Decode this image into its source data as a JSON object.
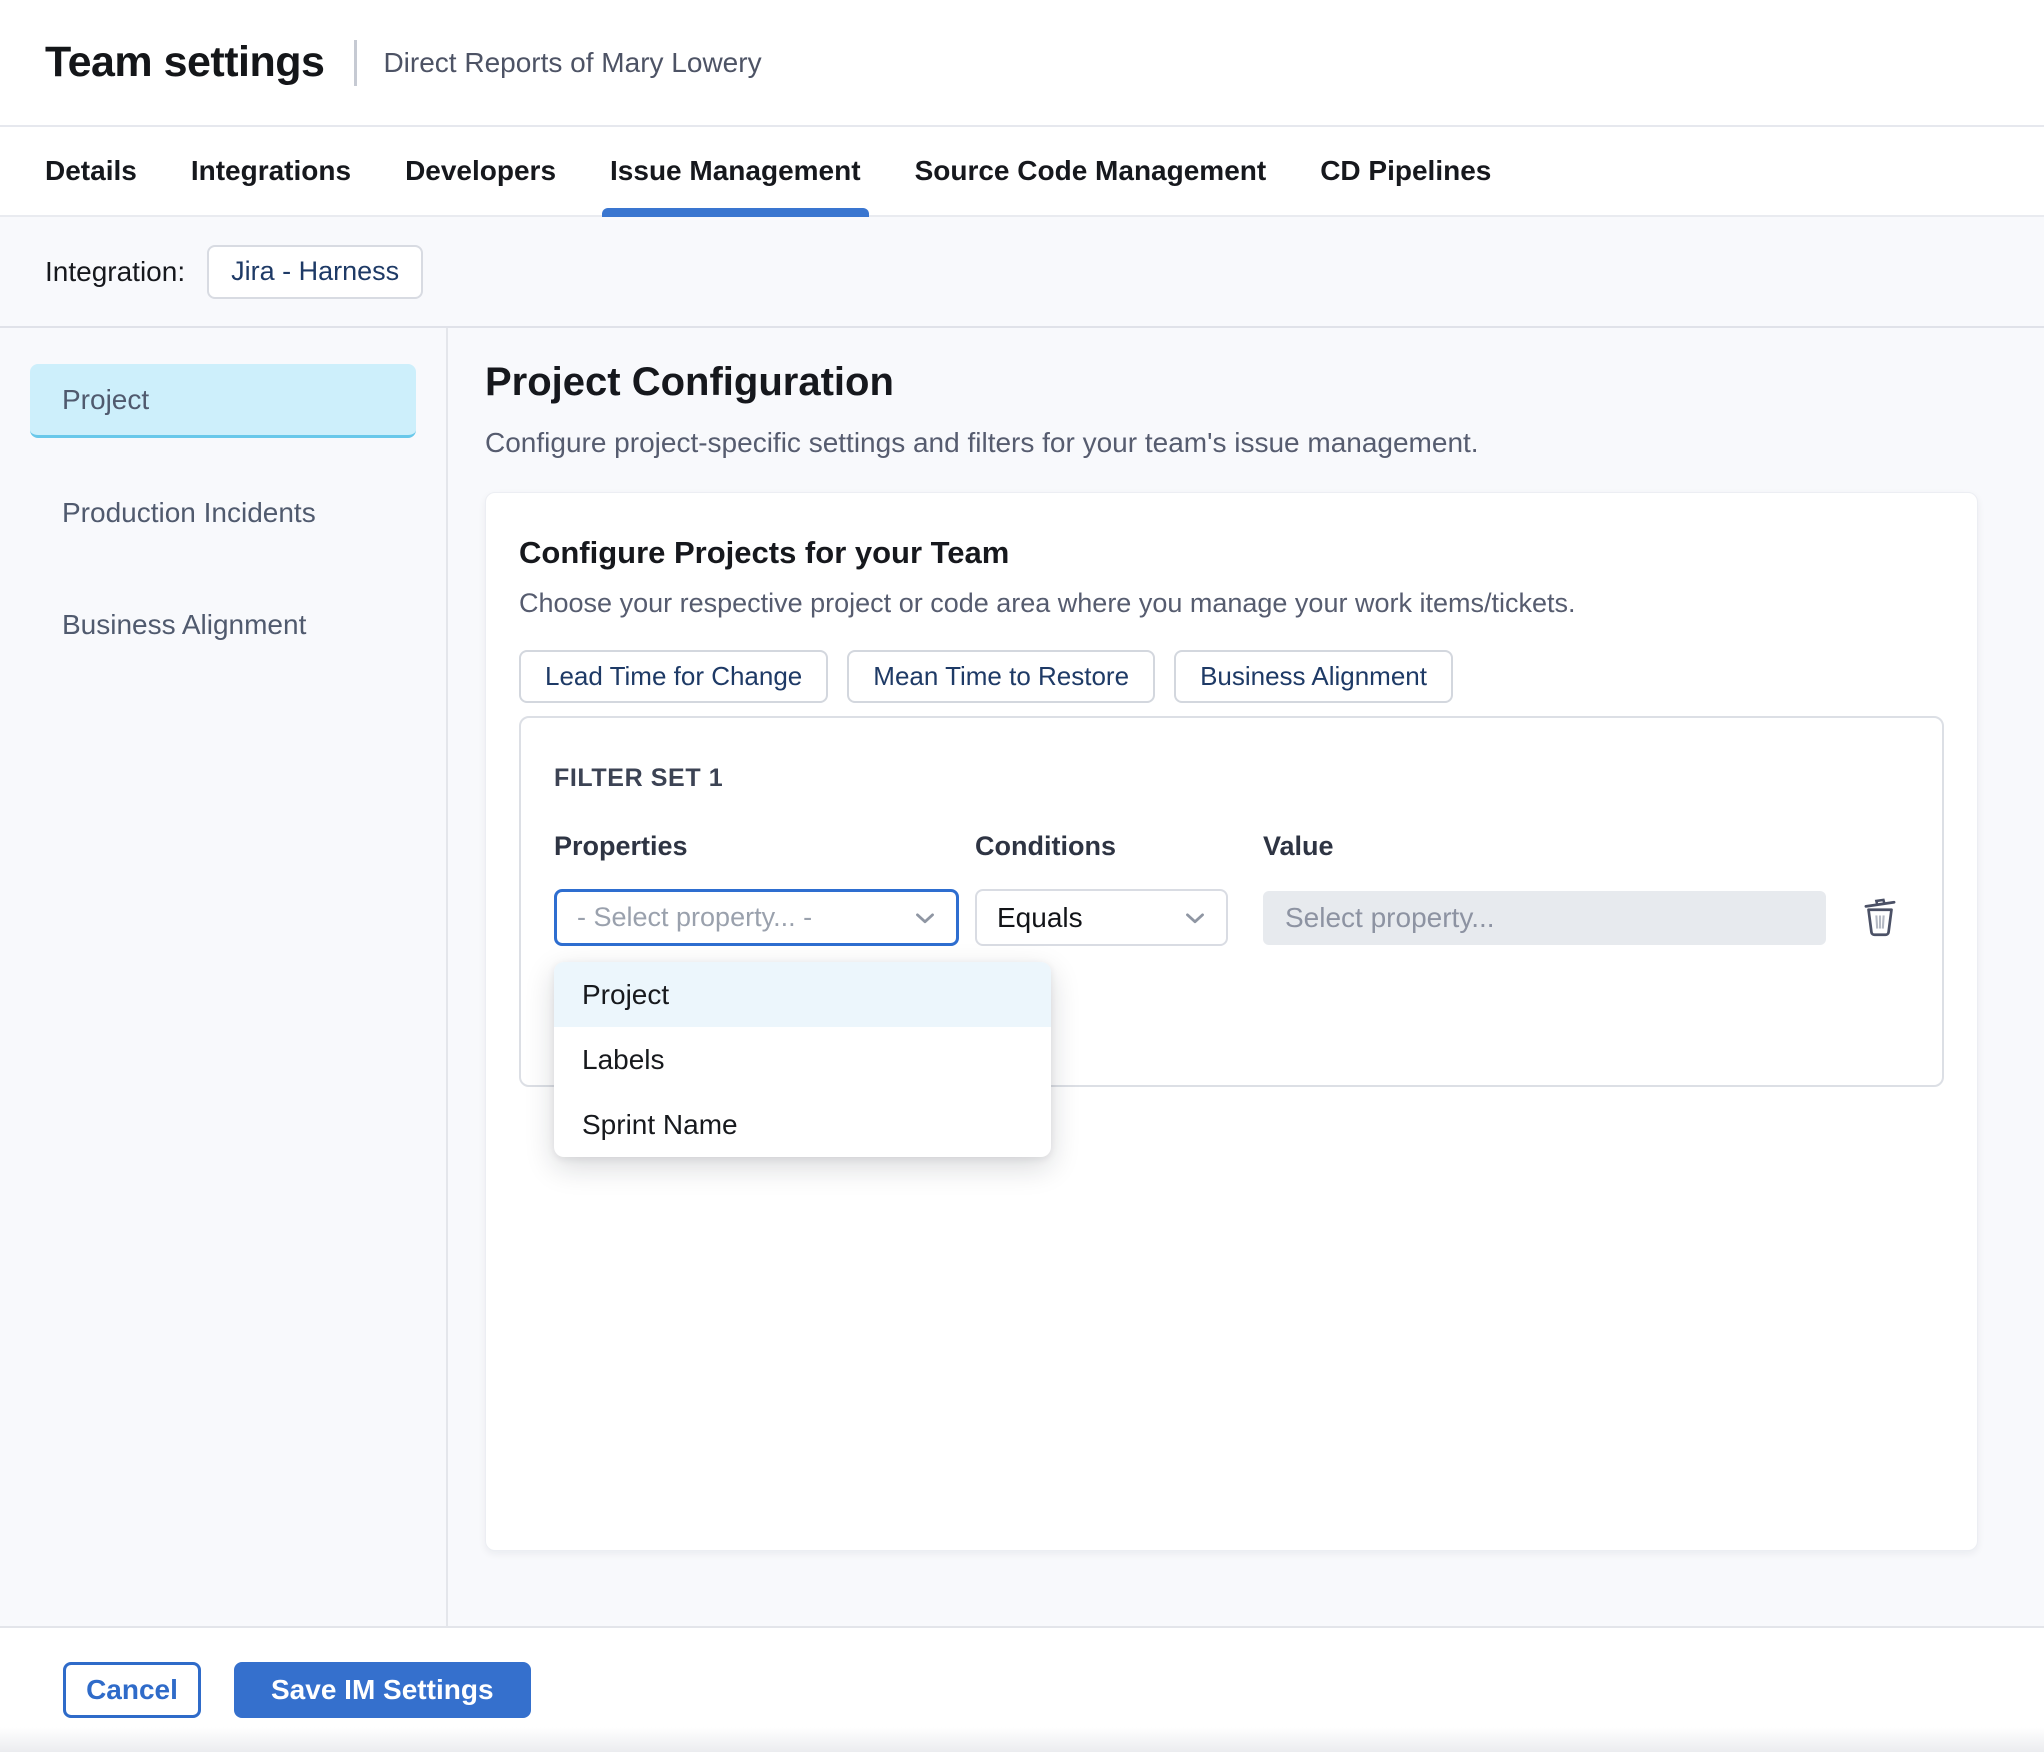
{
  "header": {
    "title": "Team settings",
    "subtitle": "Direct Reports of Mary Lowery"
  },
  "tabs": {
    "items": [
      {
        "label": "Details"
      },
      {
        "label": "Integrations"
      },
      {
        "label": "Developers"
      },
      {
        "label": "Issue Management"
      },
      {
        "label": "Source Code Management"
      },
      {
        "label": "CD Pipelines"
      }
    ],
    "active_label": "Issue Management"
  },
  "integration": {
    "label": "Integration:",
    "chip_label": "Jira - Harness"
  },
  "sidebar": {
    "items": [
      {
        "label": "Project",
        "active": true
      },
      {
        "label": "Production Incidents",
        "active": false
      },
      {
        "label": "Business Alignment",
        "active": false
      }
    ]
  },
  "main": {
    "title": "Project Configuration",
    "subtitle": "Configure project-specific settings and filters for your team's issue management.",
    "card": {
      "title": "Configure Projects for your Team",
      "subtitle": "Choose your respective project or code area where you manage your work items/tickets.",
      "chips": [
        "Lead Time for Change",
        "Mean Time to Restore",
        "Business Alignment"
      ],
      "filter_set": {
        "title": "FILTER SET 1",
        "properties_label": "Properties",
        "conditions_label": "Conditions",
        "value_label": "Value",
        "properties_placeholder": "- Select property... -",
        "conditions_value": "Equals",
        "value_placeholder": "Select property...",
        "options": [
          {
            "label": "Project",
            "highlighted": true
          },
          {
            "label": "Labels",
            "highlighted": false
          },
          {
            "label": "Sprint Name",
            "highlighted": false
          }
        ]
      }
    }
  },
  "footer": {
    "cancel_label": "Cancel",
    "save_label": "Save IM Settings"
  },
  "colors": {
    "accent_blue": "#3a76d0",
    "focus_border": "#2e6ed0",
    "active_sidebar_bg": "#cdeffb",
    "active_sidebar_border": "#69c8ea",
    "dropdown_highlight": "#ecf6fc",
    "chip_text": "#1e3a66",
    "section_bg": "#f8f9fc",
    "disabled_input_bg": "#e7eaee"
  }
}
